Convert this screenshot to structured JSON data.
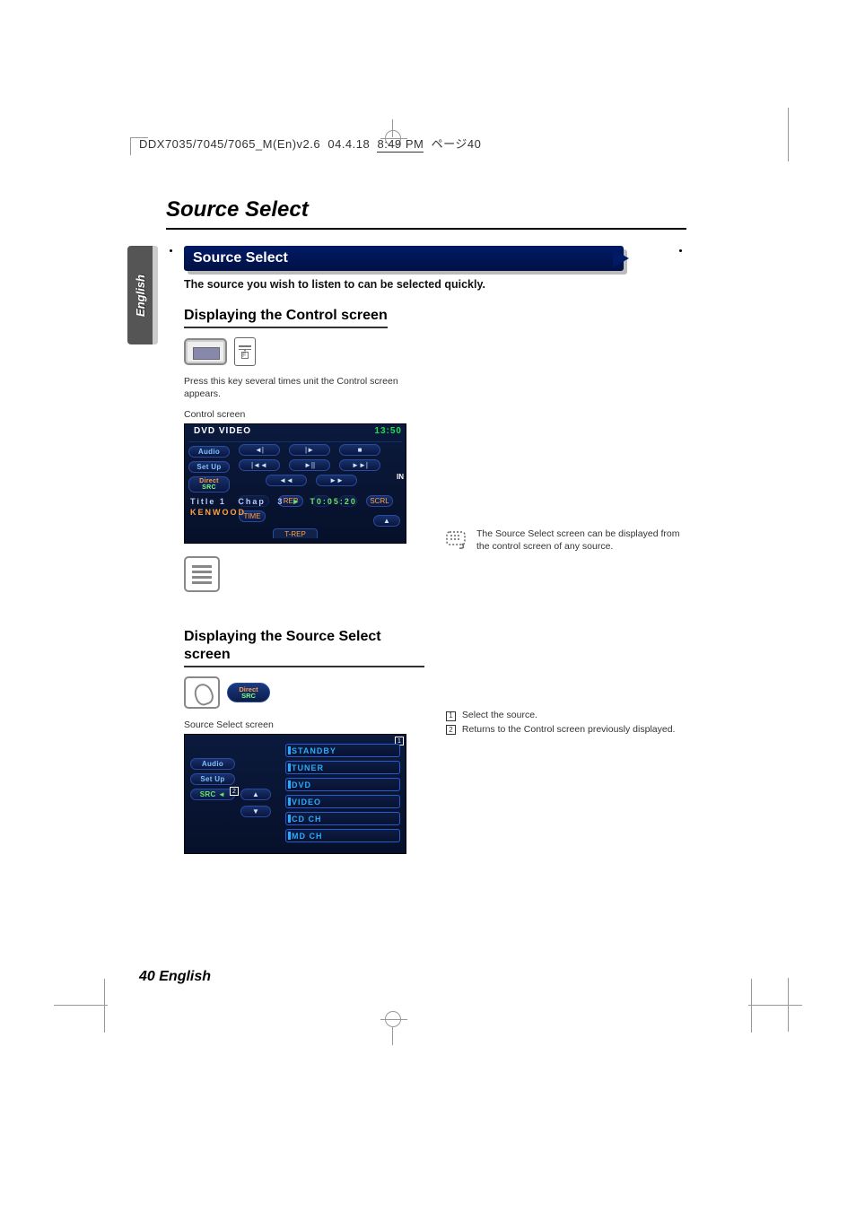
{
  "print_header": {
    "doc": "DDX7035/7045/7065_M(En)v2.6",
    "date": "04.4.18",
    "time": "8:49 PM",
    "page_ref": "ページ40"
  },
  "side_tab": "English",
  "page_title": "Source Select",
  "banner": "Source Select",
  "intro": "The source you wish to listen to can be selected quickly.",
  "section1": {
    "heading": "Displaying the Control screen",
    "instruction": "Press this key several times unit the Control screen appears.",
    "caption": "Control screen"
  },
  "control_screen": {
    "title": "DVD VIDEO",
    "clock": "13:50",
    "side_buttons": [
      "Audio",
      "Set Up",
      "Direct SRC"
    ],
    "transport_row1": [
      "◄|",
      "|►",
      "■"
    ],
    "transport_row2": [
      "|◄◄",
      "►||",
      "►►|"
    ],
    "transport_row3": [
      "◄◄",
      "►►"
    ],
    "tag_row": [
      "",
      "REP",
      "",
      "",
      "SCRL",
      "TIME"
    ],
    "status_line1": {
      "title": "Title 1",
      "chap": "Chap",
      "chap_num": "3",
      "play": "►",
      "time": "T0:05:20"
    },
    "status_line2": "KENWOOD",
    "eject": "▲",
    "footer_tab": "T-REP",
    "in_label": "IN"
  },
  "right_note": "The Source Select screen can be displayed from the control screen of any source.",
  "section2": {
    "heading": "Displaying the Source Select screen",
    "direct_button": {
      "l1": "Direct",
      "l2": "SRC"
    },
    "caption": "Source Select screen"
  },
  "source_screen": {
    "side_buttons": [
      "Audio",
      "Set Up",
      "SRC ◄"
    ],
    "list": [
      "STANDBY",
      "TUNER",
      "DVD",
      "VIDEO",
      "CD CH",
      "MD CH"
    ],
    "arrows": [
      "▲",
      "▼"
    ],
    "badge1": "1",
    "badge2": "2"
  },
  "refs": {
    "r1": {
      "n": "1",
      "text": "Select the source."
    },
    "r2": {
      "n": "2",
      "text": "Returns to the Control screen previously displayed."
    }
  },
  "footer": {
    "num": "40",
    "lang": "English"
  }
}
